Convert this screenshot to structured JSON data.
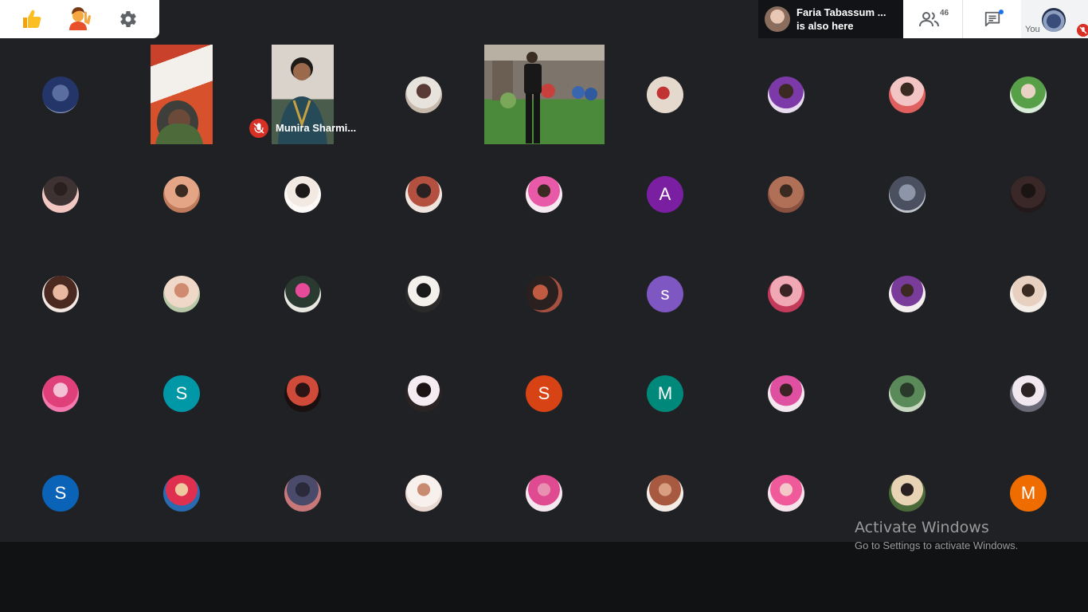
{
  "toolbar": {
    "reactions_icon": "thumbs-up-icon",
    "raise_hand_icon": "raise-hand-icon",
    "settings_icon": "gear-icon"
  },
  "notification": {
    "name": "Faria Tabassum ...",
    "message": "is also here"
  },
  "header": {
    "people_count": "46",
    "self_label": "You"
  },
  "video_tiles": [
    {
      "name": ""
    },
    {
      "name": "Munira Sharmi..."
    },
    {
      "name": ""
    }
  ],
  "letter_avatars": {
    "r1c5": {
      "letter": "A",
      "color": "#7b1fa2"
    },
    "r2c5": {
      "letter": "s",
      "color": "#7e57c2"
    },
    "r3c1": {
      "letter": "S",
      "color": "#0097a7"
    },
    "r3c4": {
      "letter": "S",
      "color": "#d84315"
    },
    "r3c5": {
      "letter": "M",
      "color": "#00897b"
    },
    "r4c0": {
      "letter": "S",
      "color": "#0b63b8"
    },
    "r4c8": {
      "letter": "M",
      "color": "#ef6c00"
    }
  },
  "watermark": {
    "title": "Activate Windows",
    "subtitle": "Go to Settings to activate Windows."
  }
}
